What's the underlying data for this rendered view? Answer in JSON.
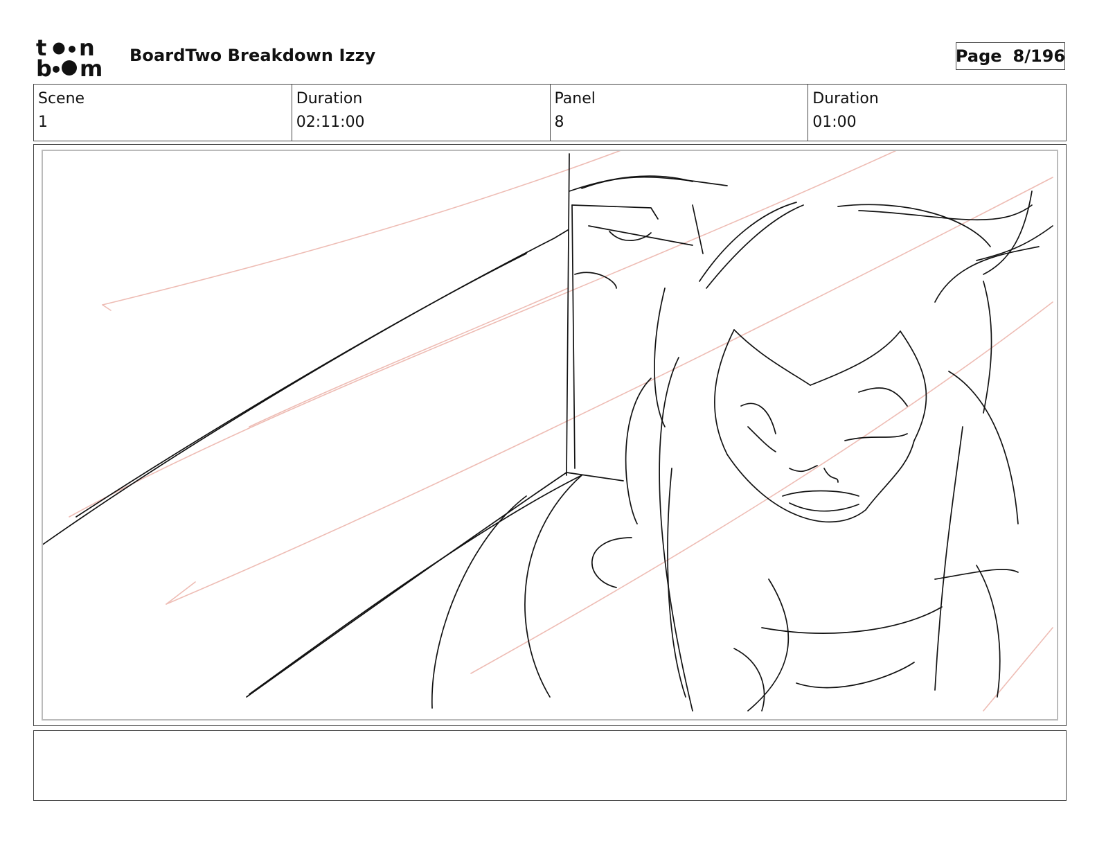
{
  "header": {
    "logo_text": "toonboom",
    "project_title": "BoardTwo Breakdown Izzy",
    "page_label": "Page",
    "page_value": "8/196"
  },
  "info": {
    "scene_label": "Scene",
    "scene_value": "1",
    "scene_duration_label": "Duration",
    "scene_duration_value": "02:11:00",
    "panel_label": "Panel",
    "panel_value": "8",
    "panel_duration_label": "Duration",
    "panel_duration_value": "01:00"
  },
  "notes": {
    "text": ""
  },
  "colors": {
    "frame_border": "#444444",
    "safe_frame": "#bbbbbb",
    "sketch_line": "#111111",
    "rough_line": "#eebcb4"
  }
}
